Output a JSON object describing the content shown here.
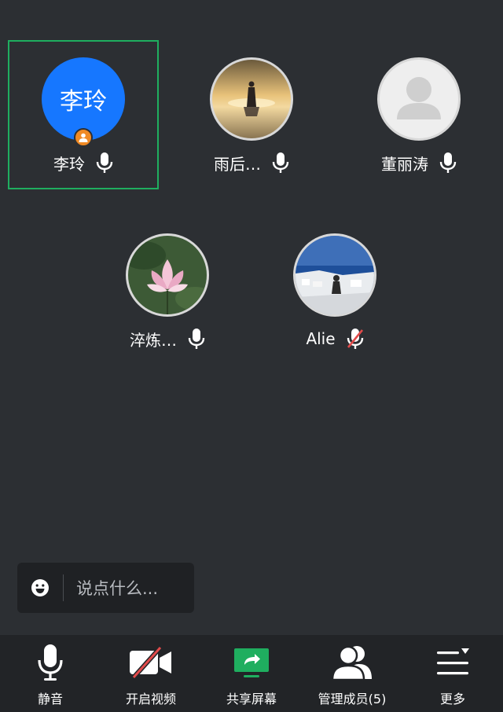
{
  "participants": [
    {
      "name": "李玲",
      "avatar_text": "李玲",
      "avatar_type": "initials",
      "host": true,
      "active_speaker": true,
      "mic": "on"
    },
    {
      "name": "雨后…",
      "avatar_type": "photo-sunset-beach",
      "host": false,
      "active_speaker": false,
      "mic": "on"
    },
    {
      "name": "董丽涛",
      "avatar_type": "default-person",
      "host": false,
      "active_speaker": false,
      "mic": "on"
    },
    {
      "name": "淬炼…",
      "avatar_type": "photo-lotus",
      "host": false,
      "active_speaker": false,
      "mic": "on"
    },
    {
      "name": "Alie",
      "avatar_type": "photo-seaside-town",
      "host": false,
      "active_speaker": false,
      "mic": "muted"
    }
  ],
  "chat": {
    "placeholder": "说点什么..."
  },
  "toolbar": {
    "mute": "静音",
    "video": "开启视频",
    "share": "共享屏幕",
    "members": "管理成员(5)",
    "more": "更多"
  },
  "colors": {
    "background": "#2c2f33",
    "toolbar": "#222427",
    "active_border": "#1fae5f",
    "avatar_blue": "#1677ff",
    "host_badge": "#f08a24",
    "muted_red": "#e24b4b",
    "share_green": "#1fae5f"
  },
  "icons": [
    "host-icon",
    "mic-icon",
    "mic-muted-icon",
    "emoji-icon",
    "video-off-icon",
    "share-screen-icon",
    "members-icon",
    "more-icon"
  ]
}
